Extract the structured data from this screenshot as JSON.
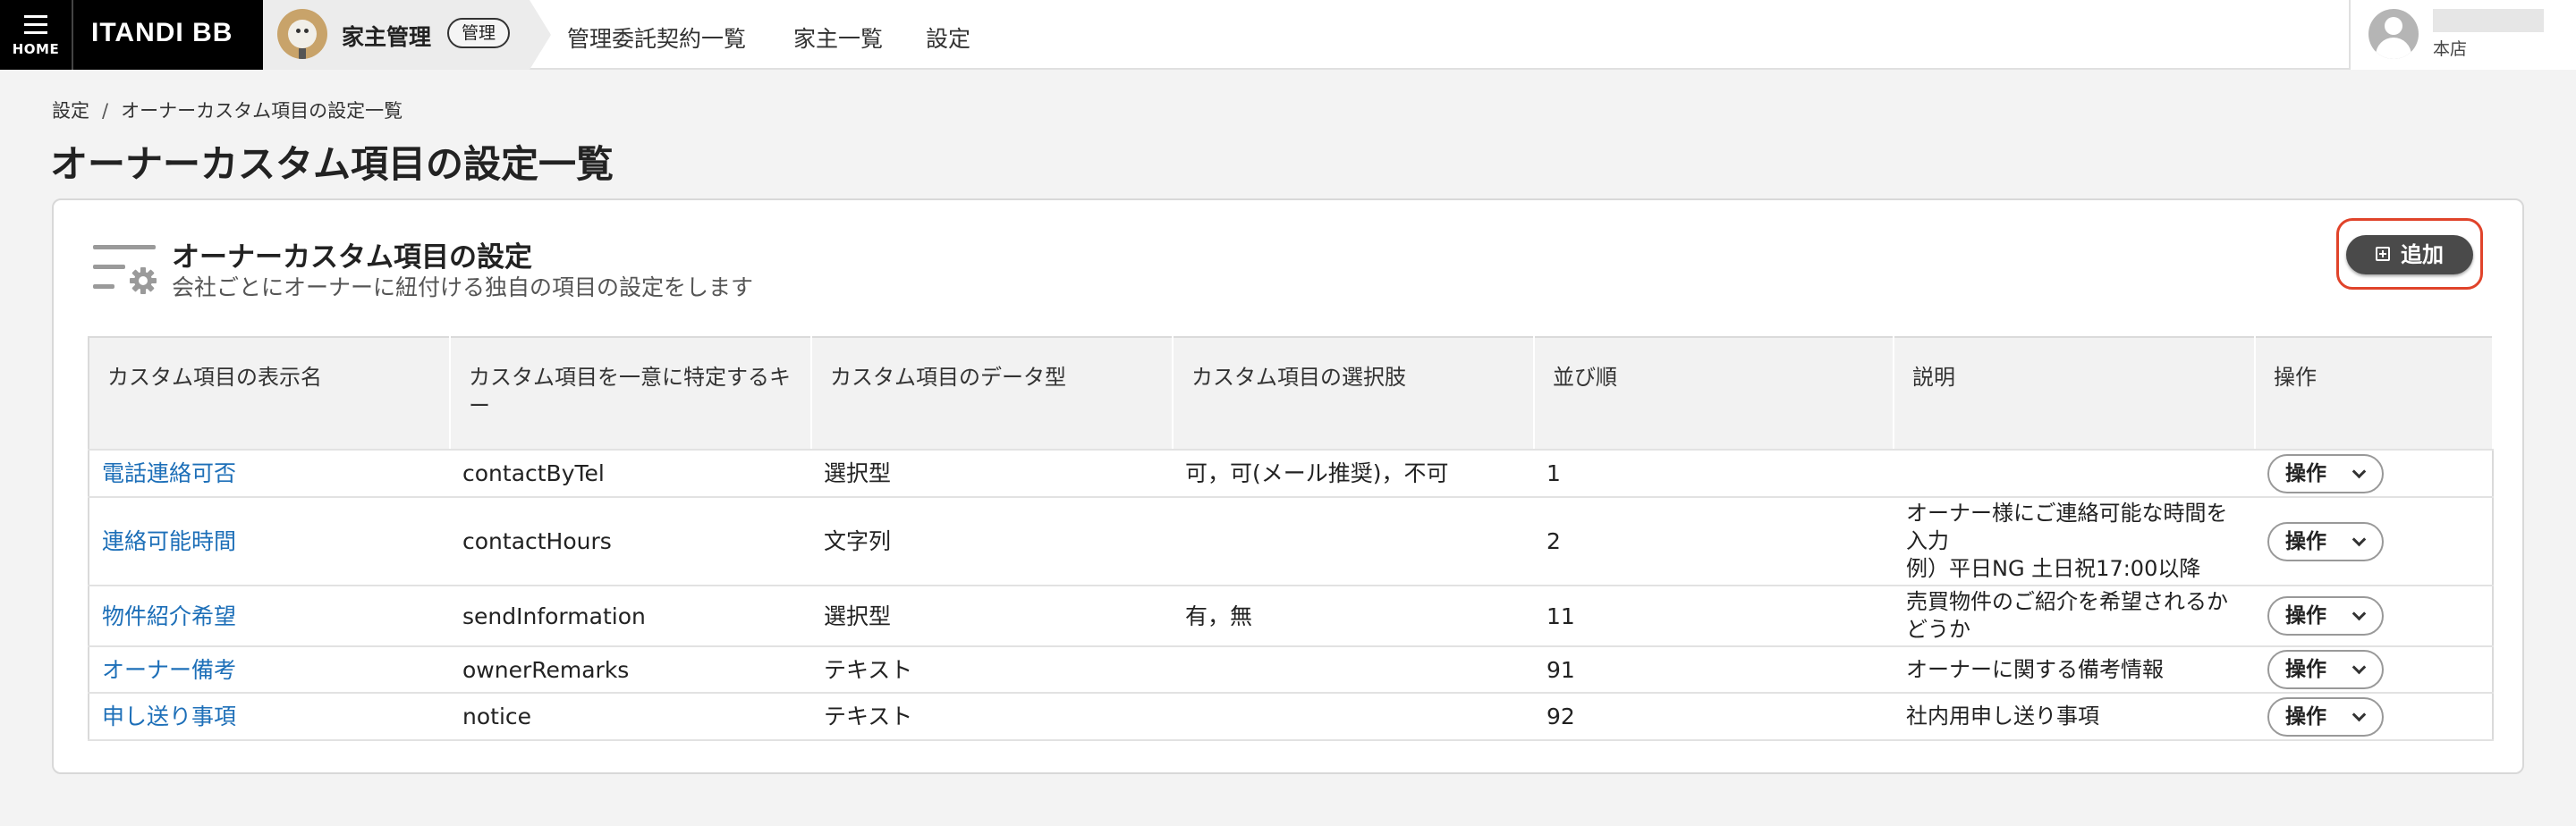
{
  "header": {
    "home_label": "HOME",
    "logo": "ITANDI BB",
    "app_name": "家主管理",
    "app_badge": "管理",
    "nav": [
      "管理委託契約一覧",
      "家主一覧",
      "設定"
    ],
    "user_branch": "本店"
  },
  "breadcrumb": {
    "root": "設定",
    "separator": "/",
    "current": "オーナーカスタム項目の設定一覧"
  },
  "page_title": "オーナーカスタム項目の設定一覧",
  "card": {
    "title": "オーナーカスタム項目の設定",
    "subtitle": "会社ごとにオーナーに紐付ける独自の項目の設定をします",
    "add_label": "追加"
  },
  "table": {
    "headers": [
      "カスタム項目の表示名",
      "カスタム項目を一意に特定するキー",
      "カスタム項目のデータ型",
      "カスタム項目の選択肢",
      "並び順",
      "説明",
      "操作"
    ],
    "rows": [
      {
        "name": "電話連絡可否",
        "key": "contactByTel",
        "type": "選択型",
        "options": "可，可(メール推奨)，不可",
        "order": "1",
        "description": "",
        "action": "操作"
      },
      {
        "name": "連絡可能時間",
        "key": "contactHours",
        "type": "文字列",
        "options": "",
        "order": "2",
        "description": "オーナー様にご連絡可能な時間を入力\n例）平日NG 土日祝17:00以降",
        "action": "操作"
      },
      {
        "name": "物件紹介希望",
        "key": "sendInformation",
        "type": "選択型",
        "options": "有，無",
        "order": "11",
        "description": "売買物件のご紹介を希望されるかどうか",
        "action": "操作"
      },
      {
        "name": "オーナー備考",
        "key": "ownerRemarks",
        "type": "テキスト",
        "options": "",
        "order": "91",
        "description": "オーナーに関する備考情報",
        "action": "操作"
      },
      {
        "name": "申し送り事項",
        "key": "notice",
        "type": "テキスト",
        "options": "",
        "order": "92",
        "description": "社内用申し送り事項",
        "action": "操作"
      }
    ]
  },
  "colors": {
    "link": "#1d6fb8",
    "add_button": "#4a4a4a",
    "highlight": "#e0432a"
  },
  "icons": [
    "menu-icon",
    "lion-avatar-icon",
    "user-avatar-icon",
    "settings-list-icon",
    "plus-square-icon",
    "chevron-down-icon"
  ]
}
